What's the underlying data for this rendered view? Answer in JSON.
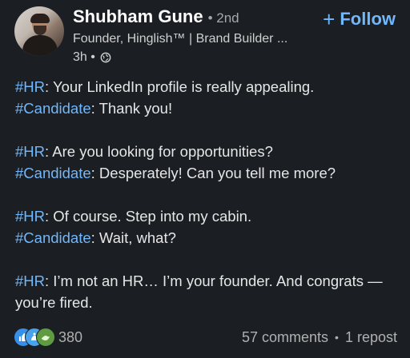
{
  "author": {
    "name": "Shubham Gune",
    "degree": "• 2nd",
    "headline": "Founder, Hinglish™ | Brand Builder ...",
    "time": "3h •"
  },
  "follow": {
    "plus": "+",
    "label": "Follow"
  },
  "post": {
    "lines": [
      {
        "tag": "#HR",
        "text": ": Your LinkedIn profile is really appealing."
      },
      {
        "tag": "#Candidate",
        "text": ": Thank you!"
      },
      {
        "tag": "#HR",
        "text": ": Are you looking for opportunities?"
      },
      {
        "tag": "#Candidate",
        "text": ": Desperately! Can you tell me more?"
      },
      {
        "tag": "#HR",
        "text": ": Of course. Step into my cabin."
      },
      {
        "tag": "#Candidate",
        "text": ": Wait, what?"
      },
      {
        "tag": "#HR",
        "text": ": I’m not an HR… I’m your founder. And congrats —you’re fired."
      }
    ]
  },
  "footer": {
    "reaction_count": "380",
    "comments": "57 comments",
    "separator": "•",
    "reposts": "1 repost"
  },
  "colors": {
    "accent": "#71b7fb",
    "background": "#1b1f23"
  },
  "icons": [
    "globe-icon",
    "like-reaction-icon",
    "celebrate-reaction-icon",
    "support-reaction-icon"
  ]
}
